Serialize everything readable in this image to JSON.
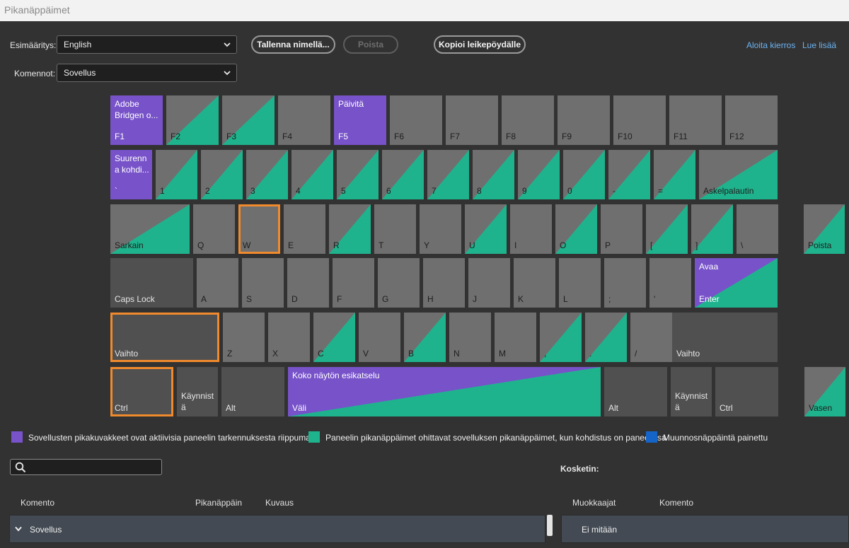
{
  "window": {
    "title": "Pikanäppäimet"
  },
  "preset": {
    "label": "Esimääritys:",
    "value": "English"
  },
  "commands": {
    "label": "Komennot:",
    "value": "Sovellus"
  },
  "buttons": {
    "save_as": "Tallenna nimellä...",
    "delete": "Poista",
    "copy_clipboard": "Kopioi leikepöydälle"
  },
  "links": {
    "tour": "Aloita kierros",
    "learn_more": "Lue lisää"
  },
  "keys": {
    "f1": "F1",
    "f1_cmd": "Adobe Bridgen o...",
    "f2": "F2",
    "f3": "F3",
    "f4": "F4",
    "f5": "F5",
    "f5_cmd": "Päivitä",
    "f6": "F6",
    "f7": "F7",
    "f8": "F8",
    "f9": "F9",
    "f10": "F10",
    "f11": "F11",
    "f12": "F12",
    "backtick": "`",
    "backtick_cmd": "Suurenn a kohdi...",
    "k1": "1",
    "k2": "2",
    "k3": "3",
    "k4": "4",
    "k5": "5",
    "k6": "6",
    "k7": "7",
    "k8": "8",
    "k9": "9",
    "k0": "0",
    "minus": "-",
    "equals": "=",
    "backspace": "Askelpalautin",
    "tab": "Sarkain",
    "q": "Q",
    "w": "W",
    "e": "E",
    "r": "R",
    "t": "T",
    "y": "Y",
    "u": "U",
    "i": "I",
    "o": "O",
    "p": "P",
    "lbracket": "[",
    "rbracket": "]",
    "backslash": "\\",
    "delete": "Poista",
    "capslock": "Caps Lock",
    "a": "A",
    "s": "S",
    "d": "D",
    "f": "F",
    "g": "G",
    "h": "H",
    "j": "J",
    "k": "K",
    "l": "L",
    "semicolon": ";",
    "quote": "'",
    "enter": "Enter",
    "enter_cmd": "Avaa",
    "lshift": "Vaihto",
    "z": "Z",
    "x": "X",
    "c": "C",
    "v": "V",
    "b": "B",
    "n": "N",
    "m": "M",
    "comma": ",",
    "period": ".",
    "slash": "/",
    "rshift": "Vaihto",
    "lctrl": "Ctrl",
    "lstart": "Käynnist ä",
    "lalt": "Alt",
    "space": "Väli",
    "space_cmd": "Koko näytön esikatselu",
    "ralt": "Alt",
    "rstart": "Käynnist ä",
    "rctrl": "Ctrl",
    "left": "Vasen"
  },
  "legend": {
    "app": "Sovellusten pikakuvakkeet ovat aktiivisia paneelin tarkennuksesta riippumatta",
    "panel": "Paneelin pikanäppäimet ohittavat sovelluksen pikanäppäimet, kun kohdistus on paneelissa",
    "modifier": "Muunnosnäppäintä painettu"
  },
  "colors": {
    "app": "#7752c9",
    "panel": "#1fb38d",
    "modifier": "#1565c8",
    "highlight": "#f08a2c"
  },
  "search": {
    "value": ""
  },
  "key_panel": {
    "title": "Kosketin:"
  },
  "table": {
    "headers": {
      "command": "Komento",
      "shortcut": "Pikanäppäin",
      "description": "Kuvaus"
    },
    "rows": [
      {
        "label": "Sovellus"
      }
    ]
  },
  "modifiers_table": {
    "headers": {
      "modifiers": "Muokkaajat",
      "command": "Komento"
    },
    "rows": [
      {
        "label": "Ei mitään"
      }
    ]
  },
  "icons": {
    "search": "search-icon",
    "dropdown": "chevron-down-icon",
    "expand": "chevron-down-icon"
  }
}
